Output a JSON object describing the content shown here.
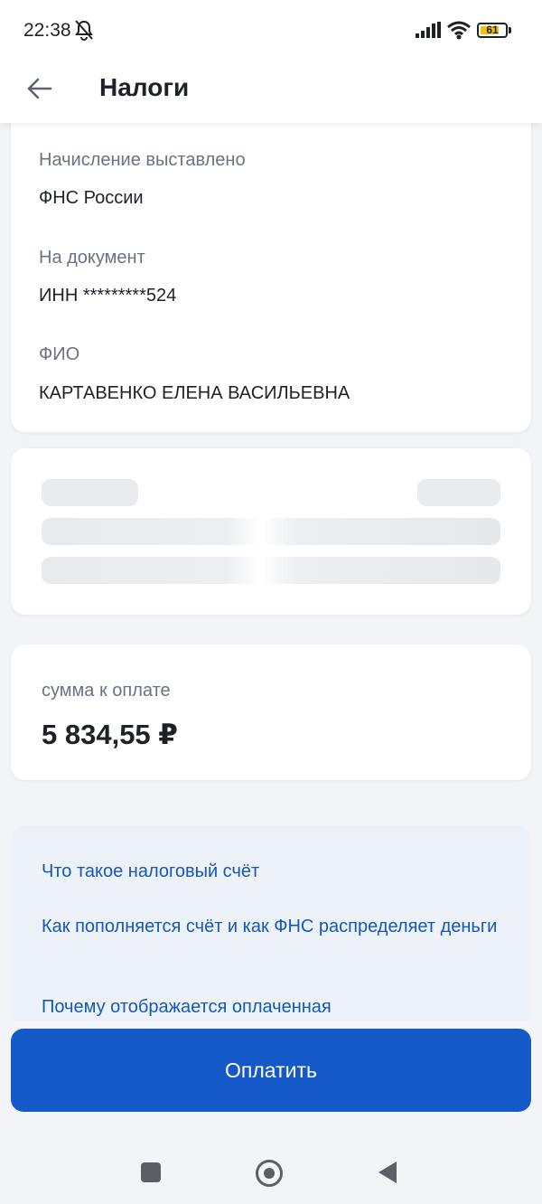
{
  "status": {
    "time": "22:38",
    "battery": "61",
    "icons": [
      "bell-off-icon",
      "signal-icon",
      "wifi-icon",
      "battery-icon"
    ]
  },
  "header": {
    "title": "Налоги",
    "back_icon": "arrow-left-icon"
  },
  "info": {
    "issued_label": "Начисление выставлено",
    "issued_value": "ФНС России",
    "document_label": "На документ",
    "document_value": "ИНН *********524",
    "name_label": "ФИО",
    "name_value": "КАРТАВЕНКО ЕЛЕНА ВАСИЛЬЕВНА"
  },
  "amount": {
    "label": "сумма к оплате",
    "value": "5 834,55 ₽"
  },
  "faq": {
    "items": [
      "Что такое налоговый счёт",
      "Как пополняется счёт и как ФНС распределяет деньги",
      "Почему отображается оплаченная"
    ]
  },
  "actions": {
    "pay_label": "Оплатить"
  },
  "colors": {
    "accent": "#1558c8",
    "link": "#1558b7",
    "background": "#f3f4f7"
  }
}
